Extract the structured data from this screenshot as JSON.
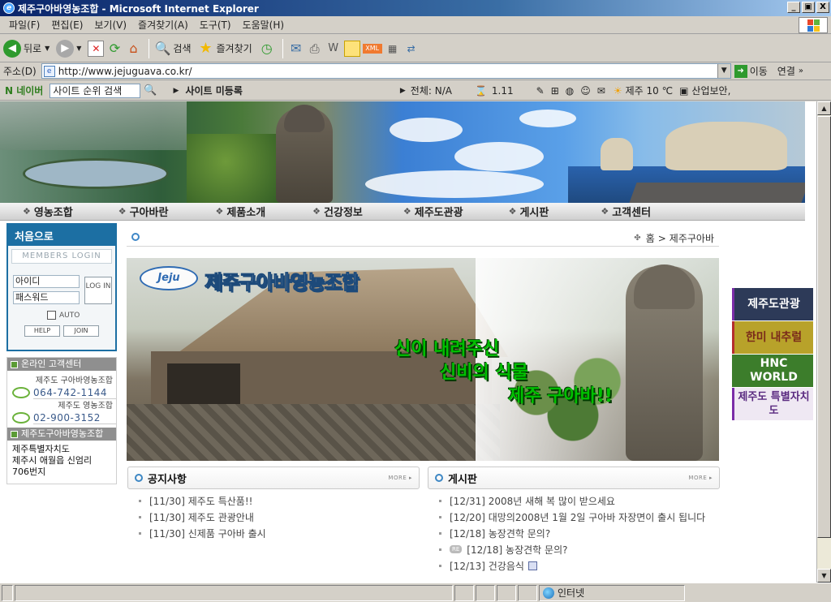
{
  "window": {
    "title": "제주구아바영농조합 - Microsoft Internet Explorer",
    "buttons": [
      "_",
      "▣",
      "X"
    ]
  },
  "menu": [
    "파일(F)",
    "편집(E)",
    "보기(V)",
    "즐겨찾기(A)",
    "도구(T)",
    "도움말(H)"
  ],
  "toolbar": {
    "back": "뒤로",
    "search": "검색",
    "favorites": "즐겨찾기"
  },
  "address": {
    "label": "주소(D)",
    "url": "http://www.jejuguava.co.kr/",
    "go": "이동",
    "links": "연결"
  },
  "naverbar": {
    "logo": "N 네이버",
    "search_placeholder": "사이트 순위 검색",
    "register": "사이트 미등록",
    "total": "전체: N/A",
    "time": "1.11",
    "weather": "제주 10 ℃",
    "finance": "산업보안,"
  },
  "status": {
    "zone": "인터넷"
  },
  "site": {
    "nav": [
      "영농조합",
      "구아바란",
      "제품소개",
      "건강정보",
      "제주도관광",
      "게시판",
      "고객센터"
    ],
    "home": "처음으로",
    "login": {
      "title": "MEMBERS LOGIN",
      "id_label": "아이디",
      "pw_label": "패스워드",
      "login_button": "LOG IN",
      "auto": "AUTO",
      "help": "HELP",
      "join": "JOIN"
    },
    "cs": {
      "title": "온라인 고객센터",
      "org1": "제주도 구아바영농조합",
      "phone1": "064-742-1144",
      "org2": "제주도 영농조합",
      "phone2": "02-900-3152",
      "title2": "제주도구아바영농조합",
      "address": [
        "제주특별자치도",
        "제주시 애월읍 신엄리",
        "706번지"
      ]
    },
    "breadcrumb": {
      "home": "홈",
      "sep": ">",
      "current": "제주구아바"
    },
    "hero": {
      "logo": "Jeju",
      "title": "제주구아바영농조합",
      "slogan": [
        "신이 내려주신",
        "신비의 식물",
        "제주 구아바!!"
      ]
    },
    "notice": {
      "title": "공지사항",
      "more": "MORE ▸",
      "items": [
        "[11/30] 제주도 특산품!!",
        "[11/30] 제주도 관광안내",
        "[11/30] 신제품 구아바 출시"
      ]
    },
    "board": {
      "title": "게시판",
      "more": "MORE ▸",
      "items": [
        {
          "text": "[12/31] 2008년 새해 복 많이 받으세요",
          "reply": false,
          "new": false
        },
        {
          "text": "[12/20] 대망의2008년 1월 2일 구아바 자장면이 출시 됩니다",
          "reply": false,
          "new": false
        },
        {
          "text": "[12/18] 농장견학 문의?",
          "reply": false,
          "new": false
        },
        {
          "text": "[12/18] 농장견학 문의?",
          "reply": true,
          "new": false
        },
        {
          "text": "[12/13] 건강음식",
          "reply": false,
          "new": true
        }
      ],
      "reply_badge": "RE"
    },
    "right_banners": [
      {
        "text": "제주도관광",
        "color": "#2d3a58",
        "border": "#7b2da8"
      },
      {
        "text": "한미 내추럴",
        "color": "#b8a22a",
        "border": "#b52d2d"
      },
      {
        "text": "HNC WORLD",
        "color": "#3c7d2b",
        "border": "#3c7d2b"
      },
      {
        "text": "제주도 특별자치도",
        "color": "#efe8f3",
        "border": "#7b2da8"
      }
    ]
  }
}
